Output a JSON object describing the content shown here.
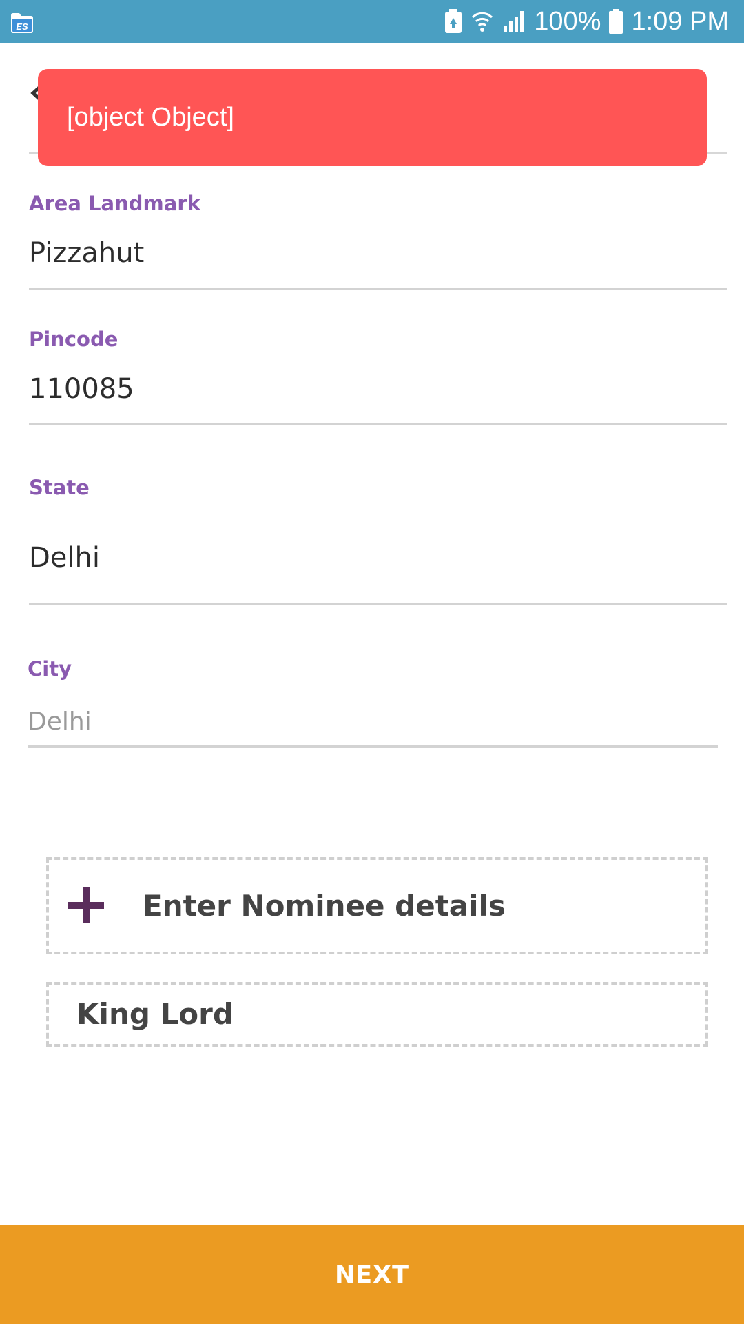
{
  "status_bar": {
    "battery_percent": "100%",
    "time": "1:09 PM",
    "icons": [
      "es-file-explorer-icon",
      "battery-saver-icon",
      "wifi-icon",
      "signal-icon",
      "battery-icon"
    ]
  },
  "toast": {
    "message": "[object Object]",
    "color": "#ff5555"
  },
  "form": {
    "area_landmark": {
      "label": "Area Landmark",
      "value": "Pizzahut"
    },
    "pincode": {
      "label": "Pincode",
      "value": "110085"
    },
    "state": {
      "label": "State",
      "value": "Delhi"
    },
    "city": {
      "label": "City",
      "value": "Delhi"
    }
  },
  "nominee": {
    "add_label": "Enter Nominee details",
    "entries": [
      "King Lord"
    ]
  },
  "footer": {
    "next_label": "NEXT",
    "color": "#eb9b22"
  },
  "colors": {
    "status_bar": "#4a9fc2",
    "label_accent": "#8a5ab0",
    "plus_icon": "#5a2d5c"
  }
}
